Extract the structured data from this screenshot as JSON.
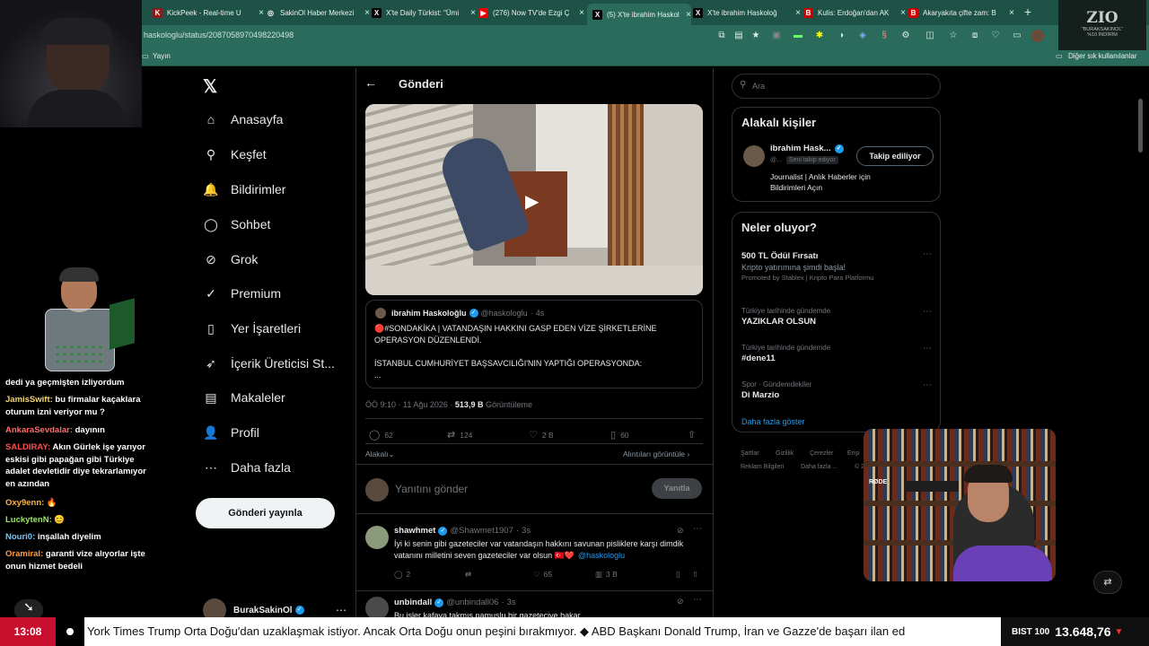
{
  "browser": {
    "tabs": [
      {
        "title": "KickPeek - Real-time U",
        "fav": "K",
        "favColor": "#8b1a1a"
      },
      {
        "title": "SakinOl Haber Merkezi",
        "fav": "◎",
        "favColor": "#1f5246"
      },
      {
        "title": "X'te Daily Türkist: \"Ümi",
        "fav": "X",
        "favColor": "#000"
      },
      {
        "title": "(276) Now TV'de Ezgi Ç",
        "fav": "▶",
        "favColor": "#e00"
      },
      {
        "title": "(5) X'te ibrahim Haskol",
        "fav": "X",
        "favColor": "#000"
      },
      {
        "title": "X'te ibrahim Haskoloğ",
        "fav": "X",
        "favColor": "#000"
      },
      {
        "title": "Kulis: Erdoğan'dan AK",
        "fav": "B",
        "favColor": "#c00"
      },
      {
        "title": "Akaryakıta çifte zam: B",
        "fav": "B",
        "favColor": "#c00"
      }
    ],
    "url": "haskologlu/status/2087058970498220498",
    "bookmark": "Yayın",
    "other_bookmarks": "Diğer sık kullanılanlar"
  },
  "zio": {
    "logo": "ZIO",
    "line1": "\"BURAKSAKINOL\"",
    "line2": "%10 İNDİRİM"
  },
  "chat": [
    {
      "user": "",
      "text": "dedi ya geçmişten izliyordum",
      "color": "#fff"
    },
    {
      "user": "JamisSwift:",
      "text": " bu firmalar kaçaklara oturum izni veriyor mu ?",
      "color": "#f5d76e"
    },
    {
      "user": "AnkaraSevdalar:",
      "text": " dayının",
      "color": "#ff6b6b"
    },
    {
      "user": "SALDIRAY:",
      "text": " Akın Gürlek işe yarıyor eskisi gibi papağan gibi Türkiye adalet devletidir diye tekrarlamıyor en azından",
      "color": "#ff4d4d"
    },
    {
      "user": "Oxy9enn:",
      "text": " 🔥",
      "color": "#ffb347"
    },
    {
      "user": "LuckytenN:",
      "text": " 😊",
      "color": "#9be564"
    },
    {
      "user": "Nouri0:",
      "text": " inşallah diyelim",
      "color": "#6ec6ff"
    },
    {
      "user": "Oramiral:",
      "text": " garanti vize alıyorlar işte onun hizmet bedeli",
      "color": "#ff9f43"
    }
  ],
  "nav": [
    {
      "label": "Anasayfa",
      "icon": "home-icon",
      "glyph": "⌂"
    },
    {
      "label": "Keşfet",
      "icon": "search-icon",
      "glyph": "⚲"
    },
    {
      "label": "Bildirimler",
      "icon": "bell-icon",
      "glyph": "🔔"
    },
    {
      "label": "Sohbet",
      "icon": "chat-icon",
      "glyph": "◯"
    },
    {
      "label": "Grok",
      "icon": "grok-icon",
      "glyph": "⊘"
    },
    {
      "label": "Premium",
      "icon": "premium-icon",
      "glyph": "✓"
    },
    {
      "label": "Yer İşaretleri",
      "icon": "bookmark-icon",
      "glyph": "▯"
    },
    {
      "label": "İçerik Üreticisi St...",
      "icon": "rocket-icon",
      "glyph": "➶"
    },
    {
      "label": "Makaleler",
      "icon": "article-icon",
      "glyph": "▤"
    },
    {
      "label": "Profil",
      "icon": "profile-icon",
      "glyph": "👤"
    },
    {
      "label": "Daha fazla",
      "icon": "more-icon",
      "glyph": "⋯"
    }
  ],
  "post_button": "Gönderi yayınla",
  "account": {
    "name": "BurakSakinOl"
  },
  "header": {
    "title": "Gönderi"
  },
  "quoted": {
    "name": "ibrahim Haskoloğlu",
    "handle": "@haskologlu",
    "time": "4s",
    "text1": "🔴#SONDAKİKA | VATANDAŞIN HAKKINI GASP EDEN VİZE ŞİRKETLERİNE OPERASYON DÜZENLENDİ.",
    "text2": "İSTANBUL CUMHURİYET BAŞSAVCILIĞI'NIN YAPTIĞI OPERASYONDA:",
    "more": "..."
  },
  "meta": {
    "time": "ÖÖ 9:10 · 11 Ağu 2026 ·",
    "views": "513,9 B",
    "views_label": "Görüntüleme"
  },
  "stats": {
    "replies": "62",
    "reposts": "124",
    "likes": "2 B",
    "bookmarks": "60"
  },
  "filter": {
    "left": "Alakalı",
    "right": "Alıntıları görüntüle"
  },
  "reply_box": {
    "placeholder": "Yanıtını gönder",
    "button": "Yanıtla"
  },
  "replies": [
    {
      "name": "shawhmet",
      "handle": "@Shawmet1907",
      "time": "3s",
      "text": "İyi ki senin gibi gazeteciler var vatandaşın hakkını savunan pisliklere karşı dimdik vatanını milletini seven gazeteciler var olsun 🇹🇷❤️",
      "mention": "@haskologlu",
      "replies": "2",
      "likes": "65",
      "views": "3 B"
    },
    {
      "name": "unbindall",
      "handle": "@unbindall06",
      "time": "3s",
      "text": "Bu işler kafaya takmış namuslu bir gazeteciye bakar"
    }
  ],
  "search": {
    "placeholder": "Ara"
  },
  "related": {
    "title": "Alakalı kişiler",
    "name": "ibrahim Hask...",
    "handle": "@...",
    "badge": "Seni takip ediyor",
    "button": "Takip ediliyor",
    "bio": "Journalist | Anlık Haberler için Bildirimleri Açın"
  },
  "trends": {
    "title": "Neler oluyor?",
    "items": [
      {
        "meta": "",
        "name": "500 TL Ödül Fırsatı",
        "sub": "Kripto yatırımına şimdi başla!",
        "promo": "Promoted by Stablex | Kripto Para Platformu"
      },
      {
        "meta": "Türkiye tarihinde gündemde",
        "name": "YAZIKLAR OLSUN"
      },
      {
        "meta": "Türkiye tarihinde gündemde",
        "name": "#dene11"
      },
      {
        "meta": "Spor · Gündemdekiler",
        "name": "Di Marzio"
      }
    ],
    "more": "Daha fazla göster"
  },
  "footer": [
    "Şartlar",
    "Gizlilik",
    "Çerezler",
    "Erişi",
    "Reklam Bilgileri",
    "Daha fazla ...",
    "© 20"
  ],
  "ticker": {
    "time": "13:08",
    "text": "York Times Trump Orta Doğu'dan uzaklaşmak istiyor. Ancak Orta Doğu onun peşini bırakmıyor.  ◆  ABD Başkanı Donald Trump, İran ve Gazze'de başarı ilan ed",
    "index": "BIST 100",
    "value": "13.648,76",
    "arrow": "▼"
  },
  "mic_label": "RØDE"
}
